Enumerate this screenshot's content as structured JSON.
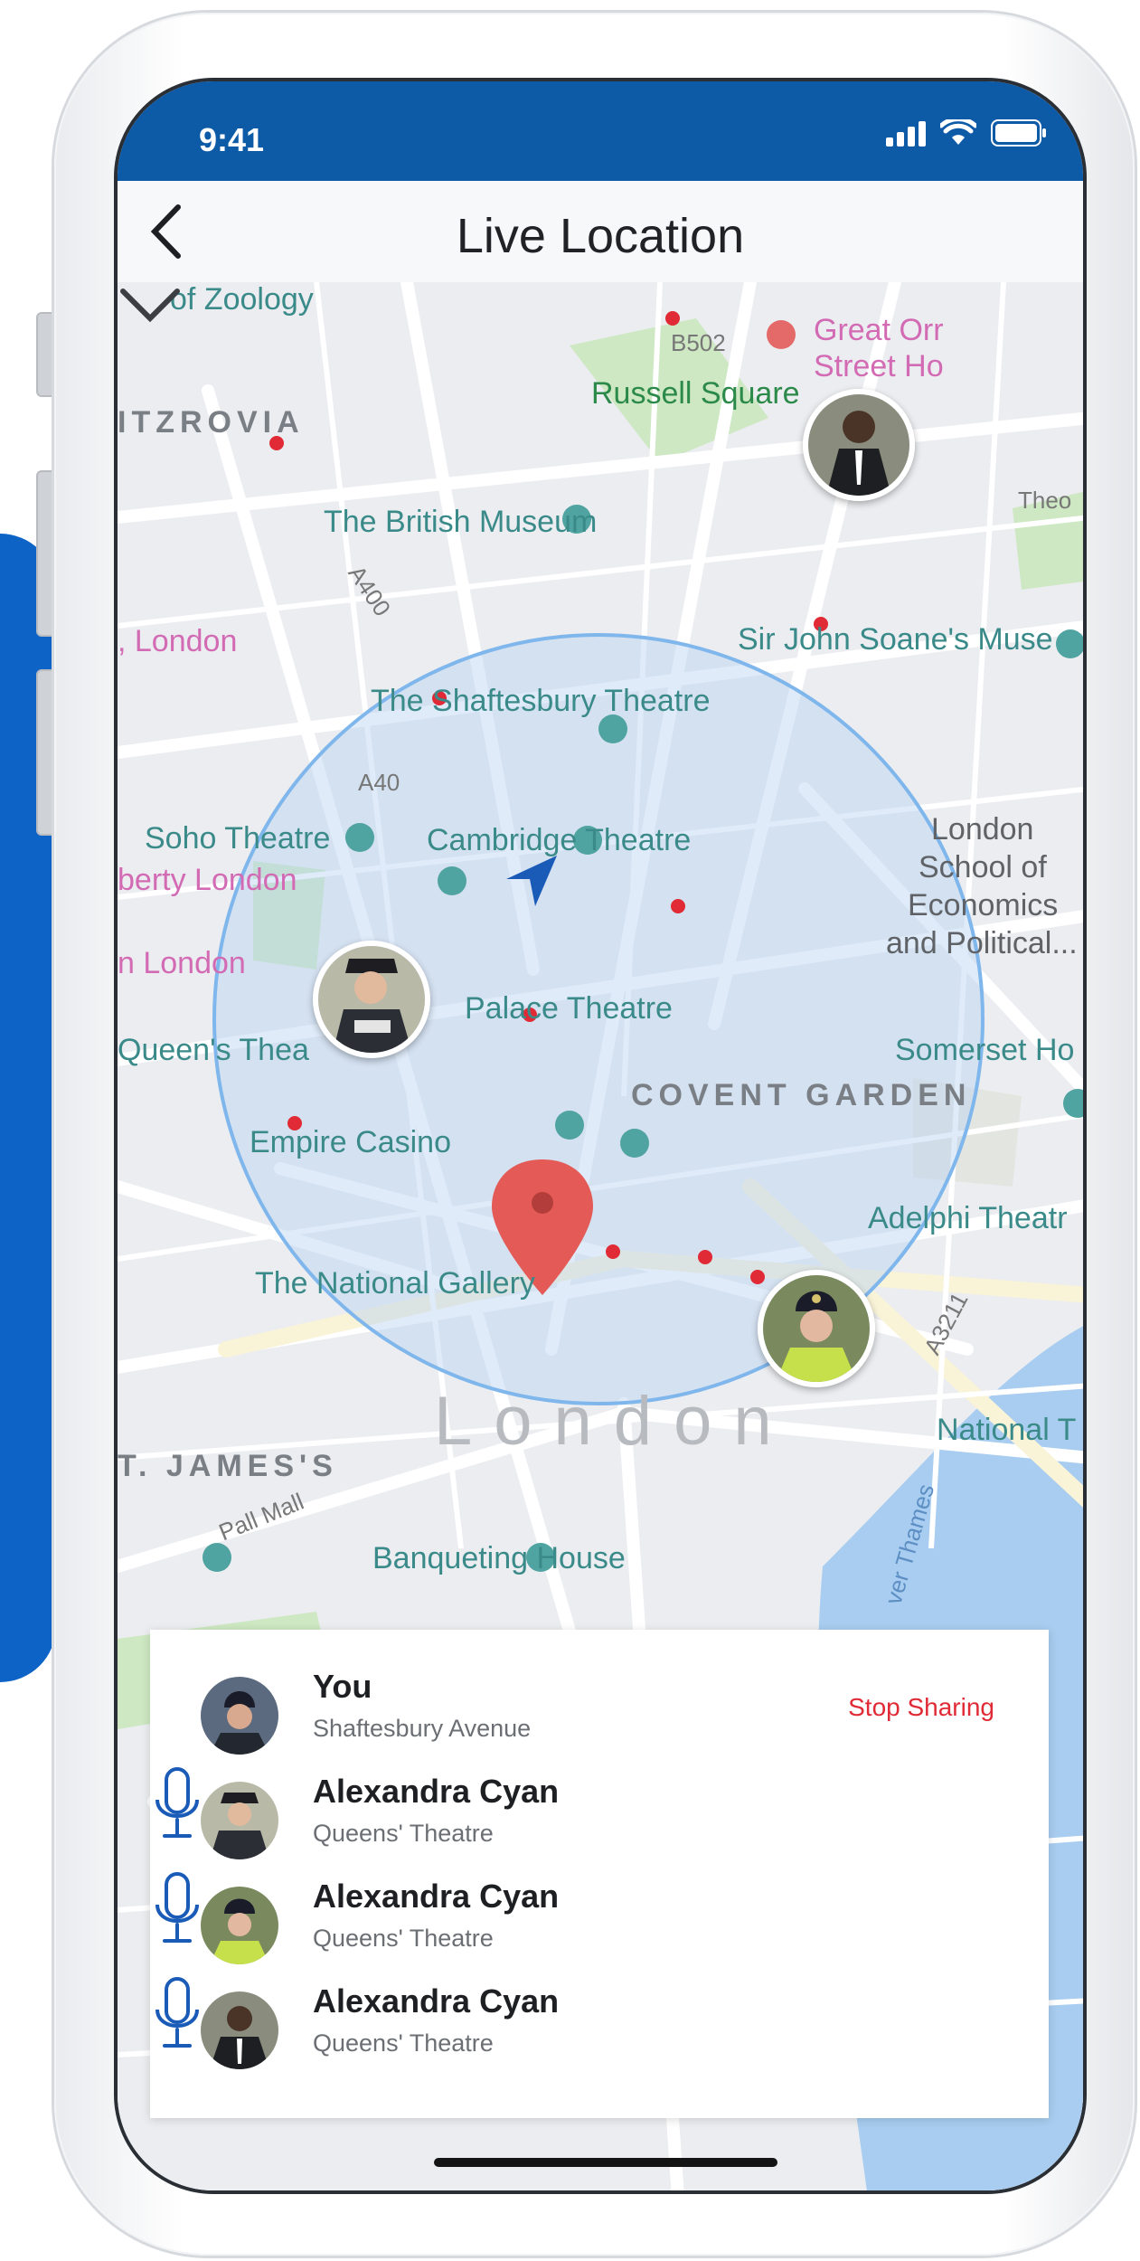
{
  "status": {
    "time": "9:41"
  },
  "header": {
    "title": "Live Location"
  },
  "map": {
    "labels": [
      "of Zoology",
      "B502",
      "Great Orr",
      "Street Ho",
      "ITZROVIA",
      "Russell Square",
      "The British Museum",
      "Theo",
      "A400",
      ", London",
      "Sir John Soane's Muse",
      "The Shaftesbury Theatre",
      "A40",
      "London",
      "School of",
      "Economics",
      "and Political...",
      "Soho Theatre",
      "Cambridge Theatre",
      "berty London",
      "n London",
      "Palace Theatre",
      "Queen's Thea",
      "Somerset Ho",
      "COVENT GARDEN",
      "Empire Casino",
      "Adelphi Theatr",
      "The National Gallery",
      "A3211",
      "National T",
      "London",
      "T. JAMES'S",
      "Pall Mall",
      "Banqueting House",
      "ver Thames"
    ]
  },
  "people": [
    {
      "name": "You",
      "place": "Shaftesbury Avenue",
      "action": "Stop Sharing"
    },
    {
      "name": "Alexandra Cyan",
      "place": "Queens' Theatre"
    },
    {
      "name": "Alexandra Cyan",
      "place": "Queens' Theatre"
    },
    {
      "name": "Alexandra Cyan",
      "place": "Queens' Theatre"
    }
  ],
  "colors": {
    "statusbar": "#0d5aa7",
    "accent": "#1a5bb8",
    "stop": "#e02a35",
    "radius": "#7fb6ec"
  }
}
